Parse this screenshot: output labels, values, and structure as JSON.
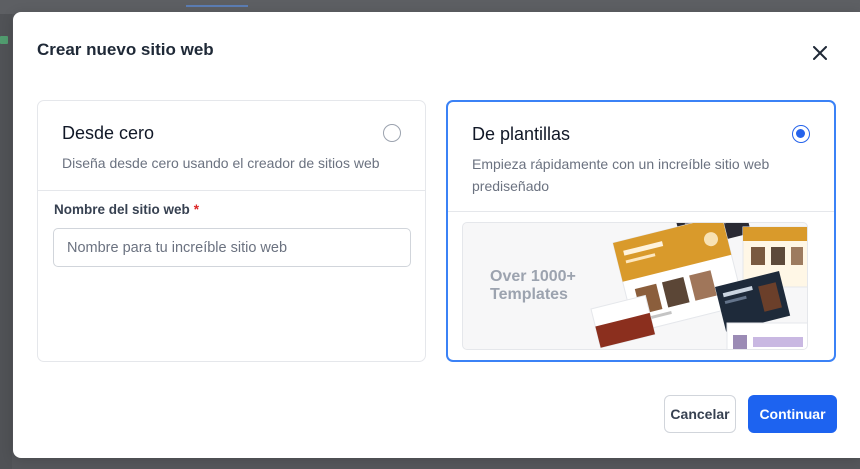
{
  "modal": {
    "title": "Crear nuevo sitio web",
    "close_icon": "close-icon"
  },
  "options": {
    "scratch": {
      "title": "Desde cero",
      "description": "Diseña desde cero usando el creador de sitios web",
      "selected": false,
      "field_label": "Nombre del sitio web",
      "required_mark": "*",
      "input_value": "",
      "input_placeholder": "Nombre para tu increíble sitio web"
    },
    "templates": {
      "title": "De plantillas",
      "description": "Empieza rápidamente con un increíble sitio web prediseñado",
      "selected": true,
      "promo_line1": "Over 1000+",
      "promo_line2": "Templates"
    }
  },
  "footer": {
    "cancel_label": "Cancelar",
    "continue_label": "Continuar"
  },
  "colors": {
    "accent": "#1d63f0",
    "selected_border": "#3b82f6",
    "required": "#dc2626",
    "template_orange": "#d99a2b",
    "template_dark": "#2a2a33"
  }
}
